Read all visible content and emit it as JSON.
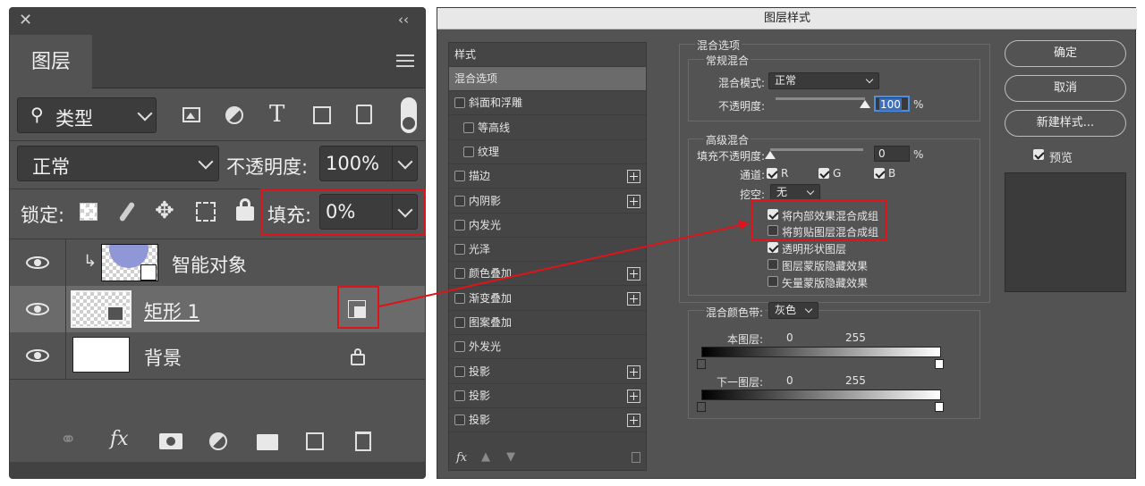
{
  "layers_panel": {
    "close_glyph": "✕",
    "collapse_glyph": "‹‹",
    "tab_label": "图层",
    "filter": {
      "search_glyph": "⚲",
      "label": "类型"
    },
    "blend_mode": "正常",
    "opacity_label": "不透明度:",
    "opacity_value": "100%",
    "lock_label": "锁定:",
    "fill_label": "填充:",
    "fill_value": "0%",
    "layers": [
      {
        "name": "智能对象"
      },
      {
        "name": "矩形 1"
      },
      {
        "name": "背景"
      }
    ],
    "fx_label": "fx"
  },
  "dialog": {
    "title": "图层样式",
    "styles_header": "样式",
    "style_items": [
      {
        "label": "混合选项",
        "checkbox": false,
        "plus": false,
        "indent": false,
        "selected": true
      },
      {
        "label": "斜面和浮雕",
        "checkbox": true,
        "plus": false,
        "indent": false
      },
      {
        "label": "等高线",
        "checkbox": true,
        "plus": false,
        "indent": true
      },
      {
        "label": "纹理",
        "checkbox": true,
        "plus": false,
        "indent": true
      },
      {
        "label": "描边",
        "checkbox": true,
        "plus": true,
        "indent": false
      },
      {
        "label": "内阴影",
        "checkbox": true,
        "plus": true,
        "indent": false
      },
      {
        "label": "内发光",
        "checkbox": true,
        "plus": false,
        "indent": false
      },
      {
        "label": "光泽",
        "checkbox": true,
        "plus": false,
        "indent": false
      },
      {
        "label": "颜色叠加",
        "checkbox": true,
        "plus": true,
        "indent": false
      },
      {
        "label": "渐变叠加",
        "checkbox": true,
        "plus": true,
        "indent": false
      },
      {
        "label": "图案叠加",
        "checkbox": true,
        "plus": false,
        "indent": false
      },
      {
        "label": "外发光",
        "checkbox": true,
        "plus": false,
        "indent": false
      },
      {
        "label": "投影",
        "checkbox": true,
        "plus": true,
        "indent": false
      },
      {
        "label": "投影",
        "checkbox": true,
        "plus": true,
        "indent": false
      },
      {
        "label": "投影",
        "checkbox": true,
        "plus": true,
        "indent": false
      }
    ],
    "footer_fx": "fx",
    "blend_options": {
      "title": "混合选项",
      "general_title": "常规混合",
      "blend_mode_label": "混合模式:",
      "blend_mode_value": "正常",
      "opacity_label": "不透明度:",
      "opacity_value": "100",
      "pct": "%",
      "opacity_level": 1.0,
      "advanced_title": "高级混合",
      "fill_opacity_label": "填充不透明度:",
      "fill_opacity_value": "0",
      "fill_level": 0.0,
      "channels_label": "通道:",
      "channels": [
        "R",
        "G",
        "B"
      ],
      "knockout_label": "挖空:",
      "knockout_value": "无",
      "checkboxes": [
        {
          "label": "将内部效果混合成组",
          "checked": true
        },
        {
          "label": "将剪贴图层混合成组",
          "checked": false
        },
        {
          "label": "透明形状图层",
          "checked": true
        },
        {
          "label": "图层蒙版隐藏效果",
          "checked": false
        },
        {
          "label": "矢量蒙版隐藏效果",
          "checked": false
        }
      ]
    },
    "blend_if": {
      "label": "混合颜色带:",
      "value": "灰色",
      "this_layer_label": "本图层:",
      "underlying_label": "下一图层:",
      "min": "0",
      "max": "255"
    },
    "buttons": {
      "ok": "确定",
      "cancel": "取消",
      "new_style": "新建样式...",
      "preview": "预览"
    }
  },
  "colors": {
    "panel_bg": "#535353",
    "highlight": "#e0131a",
    "selection": "#6b6b6b"
  }
}
